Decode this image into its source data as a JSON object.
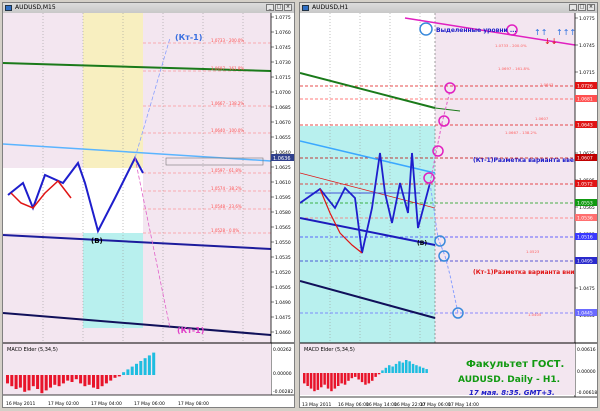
{
  "left_window": {
    "title": "AUDUSD,M15",
    "price_labels": [
      "1.0775",
      "1.0760",
      "1.0745",
      "1.0730",
      "1.0715",
      "1.0700",
      "1.0685",
      "1.0670",
      "1.0655",
      "1.0640",
      "1.0625",
      "1.0610",
      "1.0595",
      "1.0580",
      "1.0565",
      "1.0550",
      "1.0535",
      "1.0520",
      "1.0505",
      "1.0490",
      "1.0475",
      "1.0460"
    ],
    "current_price": "1.0636",
    "fib_labels": [
      "1.0733 - 200.0%",
      "1.0697 - 161.8%",
      "1.0667 - 138.2%",
      "1.0640 - 100.0%",
      "1.0597 - 61.8%",
      "1.0574 - 38.2%",
      "1.0548 - 23.6%",
      "1.0528 - 0.0%"
    ],
    "annotation_top": "(Кт-1)",
    "annotation_bottom": "(Кт-1)",
    "annotation_b": "(B)",
    "macd_title": "MACD Elder (5,34,5)",
    "macd_labels": [
      "0.00262",
      "0.00000",
      "-0.00282"
    ],
    "time_labels": [
      "16 May 2011",
      "17 May 02:00",
      "17 May 04:00",
      "17 May 06:00",
      "17 May 08:00"
    ]
  },
  "right_window": {
    "title": "AUDUSD,H1",
    "price_labels": [
      "1.0775",
      "1.0745",
      "1.0715",
      "1.0685",
      "1.0655",
      "1.0625",
      "1.0595",
      "1.0565",
      "1.0535",
      "1.0505",
      "1.0475",
      "1.0445"
    ],
    "level_labels": [
      "1.0726",
      "1.0681",
      "1.0643",
      "1.0607",
      "1.0572",
      "1.0553",
      "1.0536",
      "1.0516",
      "1.0495",
      "1.0445"
    ],
    "fib_labels": [
      "1.0733 - 200.0%",
      "1.0697 - 161.8%",
      "1.0667 - 138.2%",
      "1.0607",
      "1.0643",
      "1.0523",
      "1.0405"
    ],
    "legend_text": "Выделенные уровни ...",
    "annotation_up": "(Кт-1)Разметка варианта вверх ...",
    "annotation_down": "(Кт-1)Разметка варианта вниз ...",
    "annotation_b": "(B)",
    "macd_title": "MACD Elder (5,34,5)",
    "macd_labels": [
      "0.00616",
      "0.00000",
      "-0.00618"
    ],
    "time_labels": [
      "13 May 2011",
      "16 May 06:00",
      "16 May 14:00",
      "16 May 22:00",
      "17 May 06:00",
      "17 May 14:00"
    ],
    "faculty_title": "Факультет ГОСТ.",
    "pair_title": "AUDUSD. Daily - H1.",
    "date_text": "17 мая. 8:35. GMT+3."
  },
  "colors": {
    "pink_bg": "#f3e6f0",
    "yellow_zone": "#f8efc0",
    "cyan_zone": "#b8f0ee",
    "blue_text": "#1c1cc8",
    "green_text": "#119911",
    "red": "#e01414",
    "magenta": "#e040c8",
    "macd_pos": "#1ebde0",
    "macd_neg": "#e8142a"
  }
}
